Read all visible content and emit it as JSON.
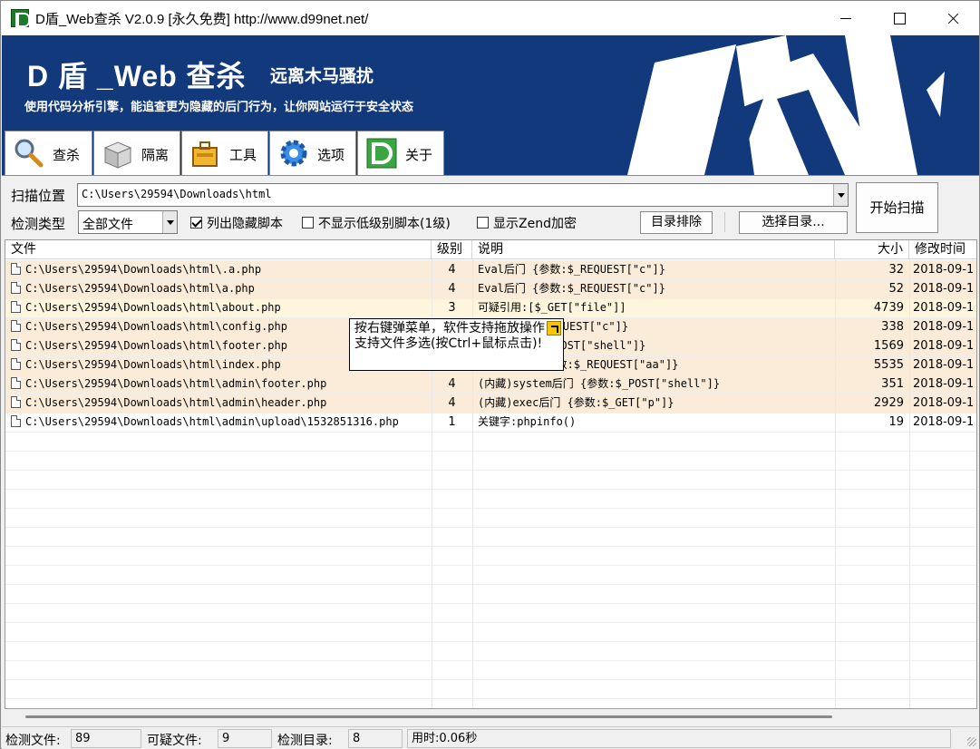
{
  "window": {
    "title": "D盾_Web查杀 V2.0.9 [永久免费] http://www.d99net.net/"
  },
  "banner": {
    "brand": "D 盾 _Web 查杀",
    "brand_sub": "远离木马骚扰",
    "slogan": "使用代码分析引擎，能追查更为隐藏的后门行为，让你网站运行于安全状态",
    "colors": {
      "background": "#11397b",
      "text": "#ffffff"
    }
  },
  "tabs": [
    {
      "label": "查杀",
      "icon": "magnifier-icon",
      "active": true
    },
    {
      "label": "隔离",
      "icon": "box-icon",
      "active": false
    },
    {
      "label": "工具",
      "icon": "toolbox-icon",
      "active": false
    },
    {
      "label": "选项",
      "icon": "gear-icon",
      "active": false
    },
    {
      "label": "关于",
      "icon": "d-logo-icon",
      "active": false
    }
  ],
  "form": {
    "scan_location_label": "扫描位置",
    "scan_location_value": "C:\\Users\\29594\\Downloads\\html",
    "detect_type_label": "检测类型",
    "detect_type_value": "全部文件",
    "opt_hidden_label": "列出隐藏脚本",
    "opt_hidden_checked": true,
    "opt_lowlevel_label": "不显示低级别脚本(1级)",
    "opt_lowlevel_checked": false,
    "opt_zend_label": "显示Zend加密",
    "opt_zend_checked": false,
    "exclude_dir_button": "目录排除",
    "choose_dir_button": "选择目录...",
    "start_scan_button": "开始扫描"
  },
  "table": {
    "columns": [
      "文件",
      "级别",
      "说明",
      "大小",
      "修改时间"
    ],
    "rows": [
      {
        "file": "C:\\Users\\29594\\Downloads\\html\\.a.php",
        "level": "4",
        "desc": "Eval后门 {参数:$_REQUEST[\"c\"]}",
        "size": "32",
        "mtime": "2018-09-1",
        "color": "#fbecd9"
      },
      {
        "file": "C:\\Users\\29594\\Downloads\\html\\a.php",
        "level": "4",
        "desc": "Eval后门 {参数:$_REQUEST[\"c\"]}",
        "size": "52",
        "mtime": "2018-09-1",
        "color": "#fbecd9"
      },
      {
        "file": "C:\\Users\\29594\\Downloads\\html\\about.php",
        "level": "3",
        "desc": "可疑引用:[$_GET[\"file\"]]",
        "size": "4739",
        "mtime": "2018-09-1",
        "color": "#fdf6dc"
      },
      {
        "file": "C:\\Users\\29594\\Downloads\\html\\config.php",
        "level": "",
        "desc": "门 {参数:$_REQUEST[\"c\"]}",
        "size": "338",
        "mtime": "2018-09-1",
        "color": "#fbecd9"
      },
      {
        "file": "C:\\Users\\29594\\Downloads\\html\\footer.php",
        "level": "",
        "desc": "后门 {参数:$_POST[\"shell\"]}",
        "size": "1569",
        "mtime": "2018-09-1",
        "color": "#fbecd9"
      },
      {
        "file": "C:\\Users\\29594\\Downloads\\html\\index.php",
        "level": "",
        "desc": "(内藏)... {参数:$_REQUEST[\"aa\"]}",
        "size": "5535",
        "mtime": "2018-09-1",
        "color": "#fbecd9"
      },
      {
        "file": "C:\\Users\\29594\\Downloads\\html\\admin\\footer.php",
        "level": "4",
        "desc": "(内藏)system后门 {参数:$_POST[\"shell\"]}",
        "size": "351",
        "mtime": "2018-09-1",
        "color": "#fbecd9"
      },
      {
        "file": "C:\\Users\\29594\\Downloads\\html\\admin\\header.php",
        "level": "4",
        "desc": "(内藏)exec后门 {参数:$_GET[\"p\"]}",
        "size": "2929",
        "mtime": "2018-09-1",
        "color": "#fbecd9"
      },
      {
        "file": "C:\\Users\\29594\\Downloads\\html\\admin\\upload\\1532851316.php",
        "level": "1",
        "desc": "关键字:phpinfo()",
        "size": "19",
        "mtime": "2018-09-1",
        "color": "#ffffff"
      }
    ]
  },
  "tooltip": {
    "text": "按右键弹菜单，软件支持拖放操作，支持文件多选(按Ctrl+鼠标点击)!"
  },
  "status": {
    "files_label": "检测文件:",
    "files_value": "89",
    "suspicious_label": "可疑文件:",
    "suspicious_value": "9",
    "dirs_label": "检测目录:",
    "dirs_value": "8",
    "time_label": "用时:0.06秒"
  }
}
